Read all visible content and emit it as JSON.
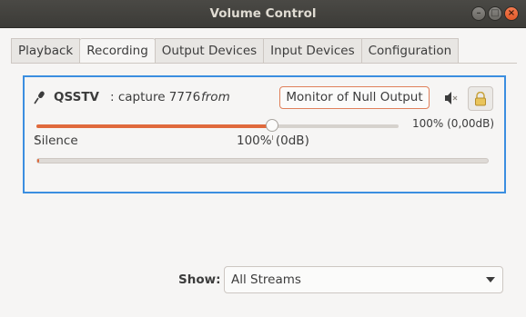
{
  "window": {
    "title": "Volume Control"
  },
  "tabs": [
    {
      "label": "Playback",
      "active": false
    },
    {
      "label": "Recording",
      "active": true
    },
    {
      "label": "Output Devices",
      "active": false
    },
    {
      "label": "Input Devices",
      "active": false
    },
    {
      "label": "Configuration",
      "active": false
    }
  ],
  "stream": {
    "app_name": "QSSTV",
    "description": ": capture 7776",
    "from_label": "from",
    "device": "Monitor of Null Output",
    "volume_readout": "100% (0,00dB)",
    "volume_fraction": 0.65,
    "meter_level_fraction": 0.004,
    "scale": {
      "left_label": "Silence",
      "mid_label": "100% (0dB)"
    },
    "icons": {
      "app": "microphone-icon",
      "mute": "speaker-mute-icon",
      "lock": "lock-icon"
    }
  },
  "footer": {
    "show_label": "Show:",
    "show_value": "All Streams"
  },
  "colors": {
    "accent": "#e06a3c",
    "focus": "#3b8ee0",
    "titlebar": "#3c3b37"
  }
}
